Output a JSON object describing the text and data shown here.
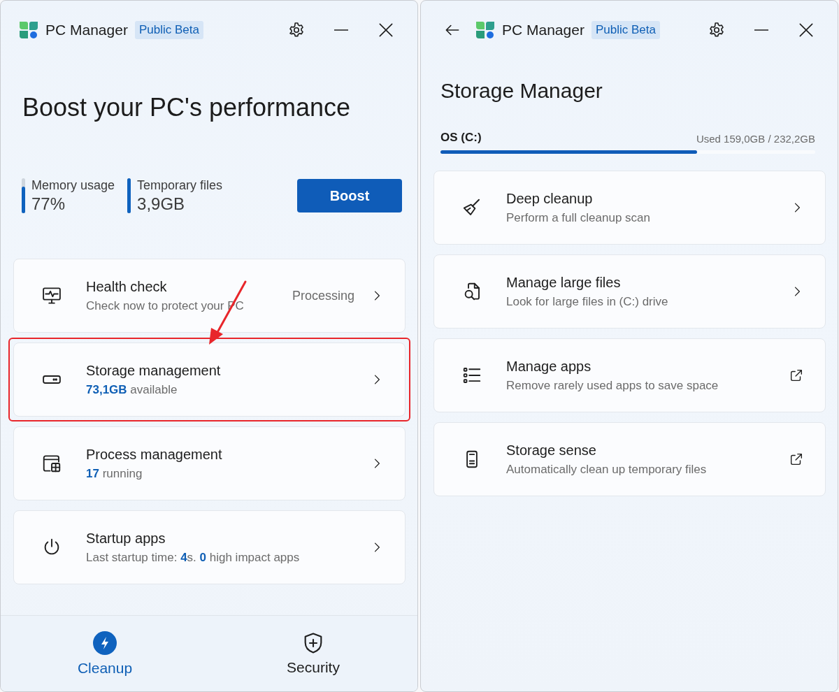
{
  "main_window": {
    "title": "PC Manager",
    "badge": "Public Beta",
    "headline": "Boost your PC's performance",
    "stats": [
      {
        "label": "Memory usage",
        "value": "77%",
        "level": 0.77
      },
      {
        "label": "Temporary files",
        "value": "3,9GB",
        "level": 1
      }
    ],
    "boost_button": "Boost",
    "cards": [
      {
        "title": "Health check",
        "subtitle": "Check now to protect your PC",
        "status": "Processing",
        "highlighted": false
      },
      {
        "title": "Storage management",
        "subtitle": "**73,1GB** available",
        "highlighted": true
      },
      {
        "title": "Process management",
        "subtitle": "**17** running",
        "highlighted": false
      },
      {
        "title": "Startup apps",
        "subtitle": "Last startup time: **4**s. **0** high impact apps",
        "highlighted": false
      }
    ],
    "nav": [
      {
        "label": "Cleanup",
        "selected": true
      },
      {
        "label": "Security",
        "selected": false
      }
    ]
  },
  "storage_window": {
    "title": "PC Manager",
    "badge": "Public Beta",
    "heading": "Storage Manager",
    "drive": {
      "name": "OS (C:)",
      "usage": "Used 159,0GB / 232,2GB",
      "level": 0.685
    },
    "items": [
      {
        "kind": "page",
        "title": "Deep cleanup",
        "subtitle": "Perform a full cleanup scan"
      },
      {
        "kind": "page",
        "title": "Manage large files",
        "subtitle": "Look for large files in (C:) drive"
      },
      {
        "kind": "external",
        "title": "Manage apps",
        "subtitle": "Remove rarely used apps to save space"
      },
      {
        "kind": "external",
        "title": "Storage sense",
        "subtitle": "Automatically clean up temporary files"
      }
    ]
  }
}
